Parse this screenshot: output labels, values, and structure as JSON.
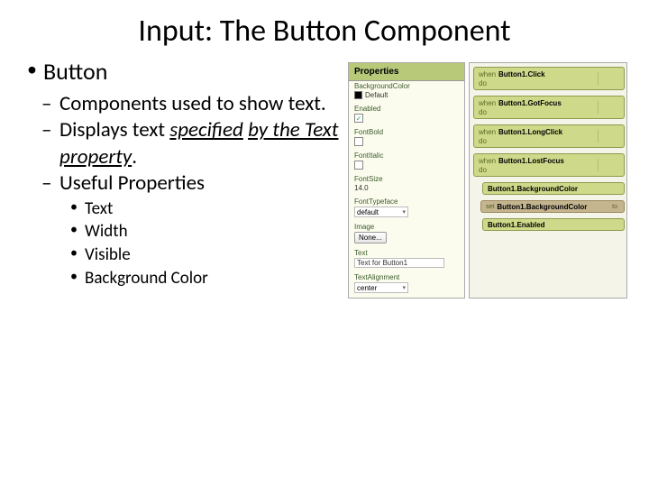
{
  "title": "Input: The Button Component",
  "bullets": {
    "lvl1": "Button",
    "lvl2a": "Components used to show text.",
    "lvl2b_pre": "Displays text ",
    "lvl2b_u1": "specified",
    "lvl2b_mid": " ",
    "lvl2b_u2": "by the Text property",
    "lvl2b_post": ".",
    "lvl2c": "Useful Properties",
    "lvl3a": "Text",
    "lvl3b": "Width",
    "lvl3c": "Visible",
    "lvl3d": "Background Color"
  },
  "props": {
    "header": "Properties",
    "bgcolor_label": "BackgroundColor",
    "bgcolor_val": "Default",
    "enabled_label": "Enabled",
    "enabled_checked": "✓",
    "fontbold_label": "FontBold",
    "fontitalic_label": "FontItalic",
    "fontsize_label": "FontSize",
    "fontsize_val": "14.0",
    "typeface_label": "FontTypeface",
    "typeface_val": "default",
    "image_label": "Image",
    "image_btn": "None...",
    "text_label": "Text",
    "text_val": "Text for Button1",
    "align_label": "TextAlignment",
    "align_val": "center"
  },
  "blocks": {
    "when": "when",
    "do": "do",
    "set": "set",
    "to": "to",
    "e1": "Button1.Click",
    "e2": "Button1.GotFocus",
    "e3": "Button1.LongClick",
    "e4": "Button1.LostFocus",
    "g1": "Button1.BackgroundColor",
    "s1": "Button1.BackgroundColor",
    "g2": "Button1.Enabled"
  }
}
